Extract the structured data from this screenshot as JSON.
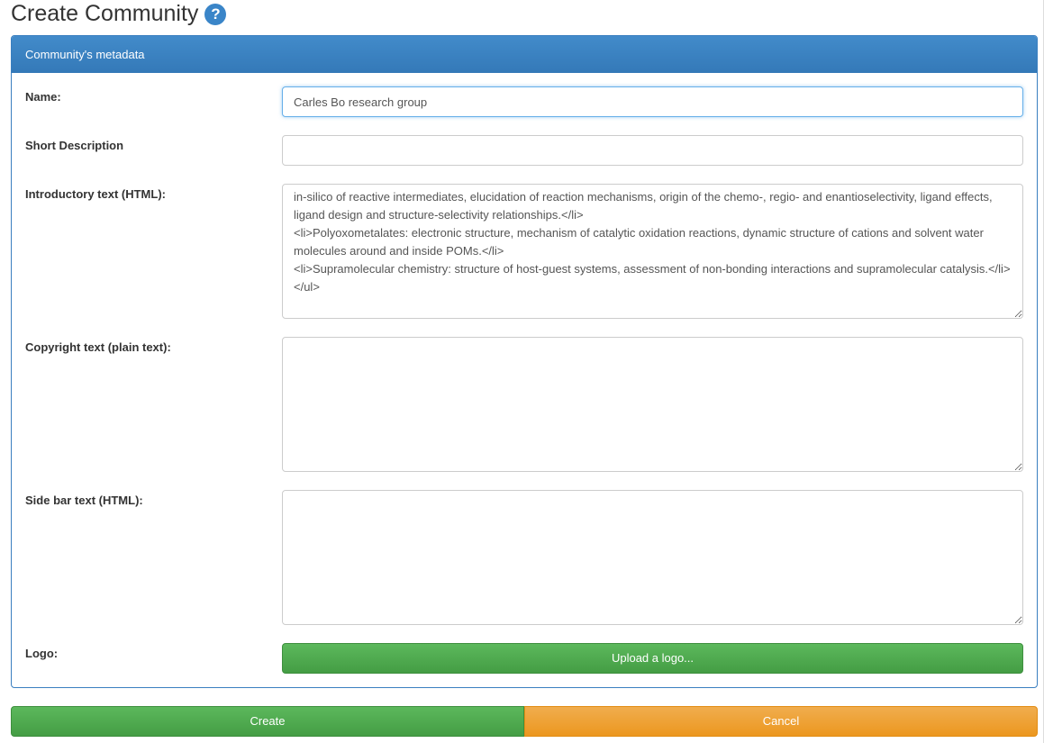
{
  "page": {
    "title": "Create Community",
    "help_icon": "question-circle-icon"
  },
  "panel": {
    "title": "Community's metadata"
  },
  "form": {
    "name": {
      "label": "Name:",
      "value": "Carles Bo research group"
    },
    "short_description": {
      "label": "Short Description",
      "value": ""
    },
    "introductory_text": {
      "label": "Introductory text (HTML):",
      "value": "in-silico of reactive intermediates, elucidation of reaction mechanisms, origin of the chemo-, regio- and enantioselectivity, ligand effects, ligand design and structure-selectivity relationships.</li>\n<li>Polyoxometalates: electronic structure, mechanism of catalytic oxidation reactions, dynamic structure of cations and solvent water molecules around and inside POMs.</li>\n<li>Supramolecular chemistry: structure of host-guest systems, assessment of non-bonding interactions and supramolecular catalysis.</li>\n</ul>"
    },
    "copyright_text": {
      "label": "Copyright text (plain text):",
      "value": ""
    },
    "side_bar_text": {
      "label": "Side bar text (HTML):",
      "value": ""
    },
    "logo": {
      "label": "Logo:",
      "button": "Upload a logo..."
    }
  },
  "actions": {
    "create": "Create",
    "cancel": "Cancel"
  },
  "colors": {
    "primary": "#428bca",
    "success": "#5cb85c",
    "warning": "#f0ad4e"
  }
}
